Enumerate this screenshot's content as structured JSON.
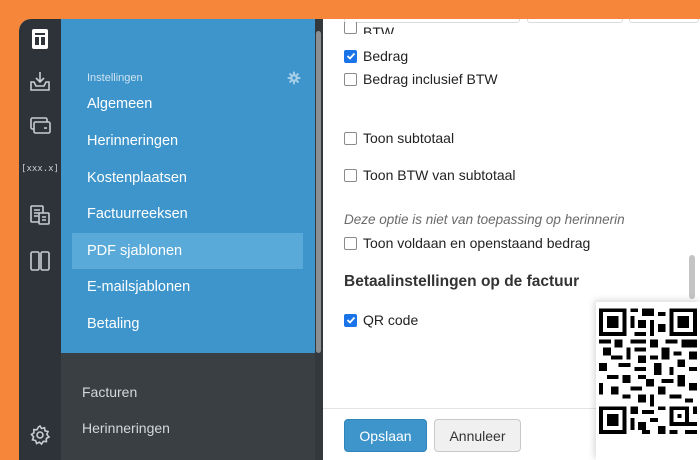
{
  "rail": {
    "icons": [
      "invoice-icon",
      "inbox-download-icon",
      "card-icon",
      "code-brackets-icon",
      "documents-icon",
      "columns-icon",
      "gear-icon"
    ],
    "code_label": "[xxx.x]"
  },
  "nav": {
    "section_title": "Instellingen",
    "items": [
      {
        "label": "Algemeen"
      },
      {
        "label": "Herinneringen"
      },
      {
        "label": "Kostenplaatsen"
      },
      {
        "label": "Factuurreeksen"
      },
      {
        "label": "PDF sjablonen",
        "active": true
      },
      {
        "label": "E-mailsjablonen"
      },
      {
        "label": "Betaling"
      }
    ],
    "bottom_items": [
      {
        "label": "Facturen"
      },
      {
        "label": "Herinneringen"
      }
    ]
  },
  "main": {
    "checkboxes": [
      {
        "label": "BTW",
        "checked": false
      },
      {
        "label": "Bedrag",
        "checked": true
      },
      {
        "label": "Bedrag inclusief BTW",
        "checked": false
      },
      {
        "label": "Toon subtotaal",
        "checked": false
      },
      {
        "label": "Toon BTW van subtotaal",
        "checked": false
      },
      {
        "label": "Toon voldaan en openstaand bedrag",
        "checked": false
      },
      {
        "label": "QR code",
        "checked": true
      }
    ],
    "note": "Deze optie is niet van toepassing op herinnerin",
    "heading": "Betaalinstellingen op de factuur",
    "save_label": "Opslaan",
    "cancel_label": "Annuleer"
  },
  "colors": {
    "frame": "#f5863a",
    "rail": "#2e3339",
    "nav_panel": "#3d95cb",
    "nav_active": "#5aaad9",
    "primary_button": "#3d95cb"
  }
}
